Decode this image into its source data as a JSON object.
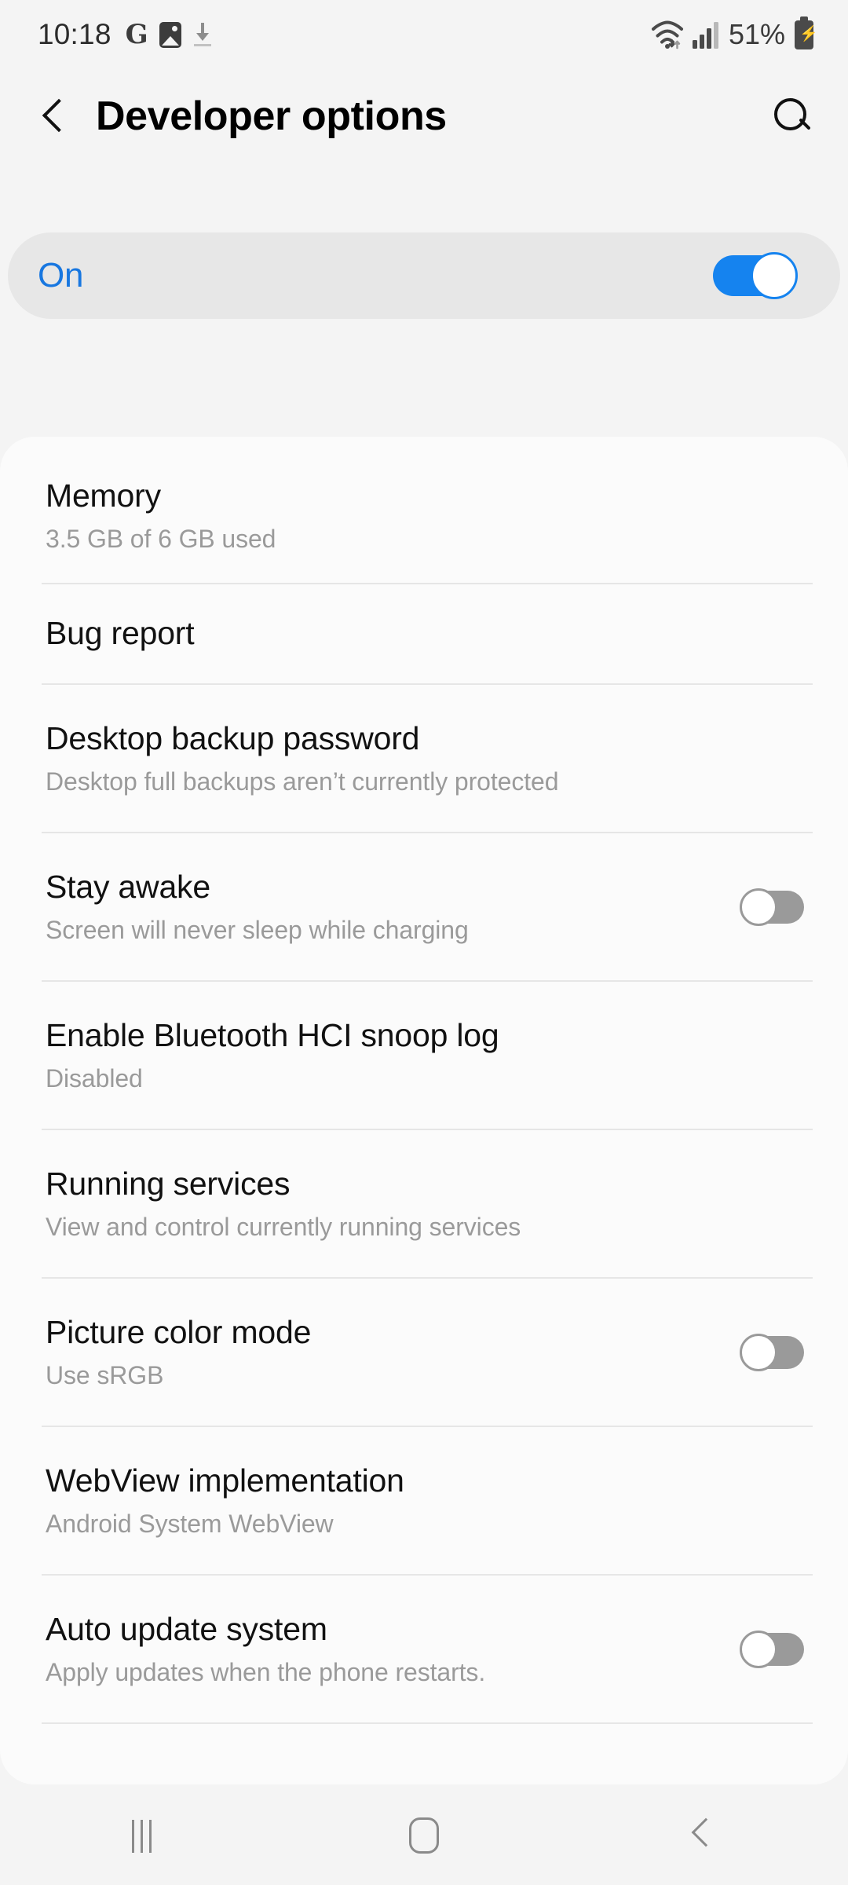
{
  "status_bar": {
    "time": "10:18",
    "left_icons": [
      "google-g-icon",
      "photos-icon",
      "download-icon"
    ],
    "wifi_icon": "wifi-icon",
    "signal_icon": "cellular-signal-icon",
    "battery_percent": "51%",
    "battery_icon": "battery-charging-icon"
  },
  "header": {
    "back_icon": "back-chevron-icon",
    "title": "Developer options",
    "search_icon": "search-icon"
  },
  "master_switch": {
    "label": "On",
    "state": "on",
    "accent_color": "#1583ef"
  },
  "settings": [
    {
      "title": "Memory",
      "summary": "3.5 GB of 6 GB used",
      "control": "none"
    },
    {
      "title": "Bug report",
      "summary": "",
      "control": "none"
    },
    {
      "title": "Desktop backup password",
      "summary": "Desktop full backups aren’t currently protected",
      "control": "none"
    },
    {
      "title": "Stay awake",
      "summary": "Screen will never sleep while charging",
      "control": "switch",
      "state": "off"
    },
    {
      "title": "Enable Bluetooth HCI snoop log",
      "summary": "Disabled",
      "control": "none"
    },
    {
      "title": "Running services",
      "summary": "View and control currently running services",
      "control": "none"
    },
    {
      "title": "Picture color mode",
      "summary": "Use sRGB",
      "control": "switch",
      "state": "off"
    },
    {
      "title": "WebView implementation",
      "summary": "Android System WebView",
      "control": "none"
    },
    {
      "title": "Auto update system",
      "summary": "Apply updates when the phone restarts.",
      "control": "switch",
      "state": "off"
    }
  ],
  "nav_bar": {
    "recents_label": "recents-icon",
    "home_label": "home-icon",
    "back_label": "back-icon"
  },
  "colors": {
    "page_background": "#f4f4f4",
    "card_background": "#fbfbfb",
    "master_card_background": "#e7e7e7",
    "accent": "#1583ef",
    "title_text": "#111111",
    "summary_text": "#9a9a9a",
    "divider": "#e6e6e6"
  }
}
